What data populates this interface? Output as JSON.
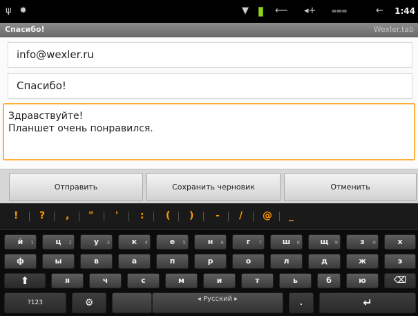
{
  "status_bar": {
    "usb_icon": "usb-icon",
    "android_icon": "android-icon",
    "wifi_icon": "wifi-icon",
    "battery_color": "#8fd21a",
    "time": "1:44"
  },
  "title_bar": {
    "title": "Спасибо!",
    "app_name": "Wexler.tab"
  },
  "form": {
    "to_value": "info@wexler.ru",
    "subject_value": "Спасибо!",
    "body_line1": "Здравствуйте!",
    "body_line2": "Планшет очень понравился.",
    "focus_color": "#ffae3a"
  },
  "actions": {
    "send_label": "Отправить",
    "save_draft_label": "Сохранить черновик",
    "cancel_label": "Отменить"
  },
  "keyboard": {
    "candidates": [
      "!",
      "?",
      ",",
      "\"",
      "'",
      ":",
      "(",
      ")",
      "-",
      "/",
      "@",
      "_"
    ],
    "candidate_color": "#ff9a00",
    "row1": [
      {
        "label": "й",
        "hint": "1"
      },
      {
        "label": "ц",
        "hint": "2"
      },
      {
        "label": "у",
        "hint": "3"
      },
      {
        "label": "к",
        "hint": "4"
      },
      {
        "label": "е",
        "hint": "5"
      },
      {
        "label": "н",
        "hint": "6"
      },
      {
        "label": "г",
        "hint": "7"
      },
      {
        "label": "ш",
        "hint": "8"
      },
      {
        "label": "щ",
        "hint": "9"
      },
      {
        "label": "з",
        "hint": "0"
      },
      {
        "label": "х",
        "hint": ""
      }
    ],
    "row2": [
      "ф",
      "ы",
      "в",
      "а",
      "п",
      "р",
      "о",
      "л",
      "д",
      "ж",
      "э"
    ],
    "row3": [
      "я",
      "ч",
      "с",
      "м",
      "и",
      "т",
      "ь",
      "б",
      "ю"
    ],
    "shift_icon": "shift-icon",
    "delete_icon": "backspace-icon",
    "symbols_label": "?123",
    "settings_icon": "settings-icon",
    "language_label": "Русский",
    "period_label": ".",
    "enter_icon": "enter-icon"
  }
}
